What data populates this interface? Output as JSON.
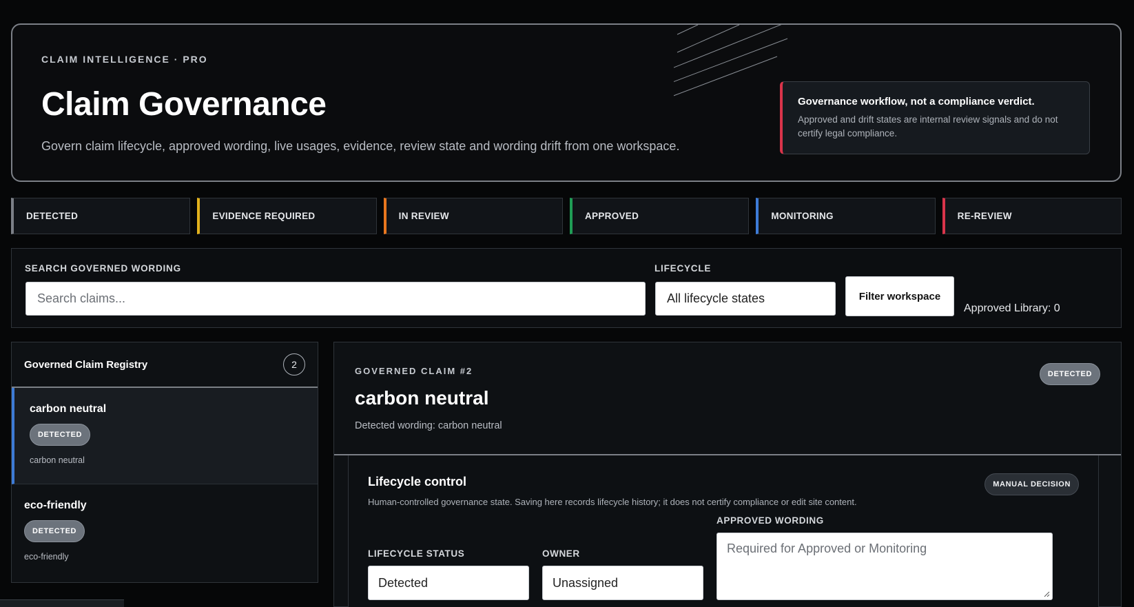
{
  "hero": {
    "eyebrow": "CLAIM INTELLIGENCE · PRO",
    "title": "Claim Governance",
    "subtitle": "Govern claim lifecycle, approved wording, live usages, evidence, review state and wording drift from one workspace.",
    "notice_title": "Governance workflow, not a compliance verdict.",
    "notice_body": "Approved and drift states are internal review signals and do not certify legal compliance."
  },
  "status_tabs": [
    {
      "label": "DETECTED",
      "color": "#7c8087"
    },
    {
      "label": "EVIDENCE REQUIRED",
      "color": "#e3b21c"
    },
    {
      "label": "IN REVIEW",
      "color": "#e8761e"
    },
    {
      "label": "APPROVED",
      "color": "#1f9d55"
    },
    {
      "label": "MONITORING",
      "color": "#3d7bd6"
    },
    {
      "label": "RE-REVIEW",
      "color": "#d9344a"
    }
  ],
  "filters": {
    "search_label": "SEARCH GOVERNED WORDING",
    "search_placeholder": "Search claims...",
    "lifecycle_label": "LIFECYCLE",
    "lifecycle_value": "All lifecycle states",
    "filter_button": "Filter workspace",
    "library_count": "Approved Library: 0"
  },
  "registry": {
    "title": "Governed Claim Registry",
    "count": "2",
    "items": [
      {
        "name": "carbon neutral",
        "status": "DETECTED",
        "wording": "carbon neutral"
      },
      {
        "name": "eco-friendly",
        "status": "DETECTED",
        "wording": "eco-friendly"
      }
    ]
  },
  "detail": {
    "eyebrow": "GOVERNED CLAIM #2",
    "title": "carbon neutral",
    "status": "DETECTED",
    "detected_wording": "Detected wording: carbon neutral",
    "lifecycle": {
      "title": "Lifecycle control",
      "subtitle": "Human-controlled governance state. Saving here records lifecycle history; it does not certify compliance or edit site content.",
      "badge": "MANUAL DECISION",
      "status_label": "LIFECYCLE STATUS",
      "status_value": "Detected",
      "owner_label": "OWNER",
      "owner_value": "Unassigned",
      "approved_label": "APPROVED WORDING",
      "approved_placeholder": "Required for Approved or Monitoring"
    }
  },
  "colors": {
    "accent_blue": "#3d7bd6",
    "alert_red": "#d9344a"
  }
}
